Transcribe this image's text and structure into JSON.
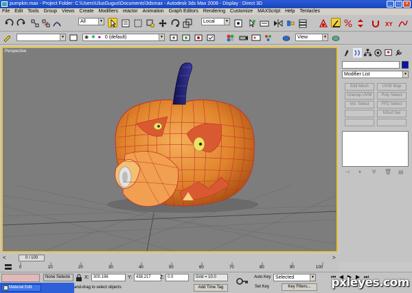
{
  "window": {
    "title": "pumpkin.max  - Project Folder: C:\\Users\\UlusGugus\\Documents\\3dsmax  - Autodesk 3ds Max 2008  - Display : Direct 3D"
  },
  "menu": [
    "File",
    "Edit",
    "Tools",
    "Group",
    "Views",
    "Create",
    "Modifiers",
    "reactor",
    "Animation",
    "Graph Editors",
    "Rendering",
    "Customize",
    "MAXScript",
    "Help",
    "Tentacles"
  ],
  "toolbar": {
    "selection_filter": "All",
    "ref_coord": "Local",
    "named_selection": "",
    "view_select": "View"
  },
  "layer_bar": {
    "layer_name": "0 (default)"
  },
  "viewport": {
    "label": "Perspective",
    "border_color": "#e8c23a",
    "bg_color": "#7d7d7d"
  },
  "command_panel": {
    "modifier_list": "Modifier List",
    "object_color": "#0a13a8",
    "buttons": [
      "Edit Mesh",
      "UVW Map",
      "Unwrap UVW",
      "Poly Select",
      "Vol. Select",
      "FFD Select",
      "",
      "NSurf Sel",
      "",
      ""
    ]
  },
  "time_slider": {
    "position": "0 / 100"
  },
  "trackbar": {
    "ticks": [
      "0",
      "10",
      "20",
      "30",
      "40",
      "50",
      "60",
      "70",
      "80",
      "90",
      "100"
    ]
  },
  "status": {
    "selection": "None Selecte",
    "x_label": "X:",
    "x_value": "300.196",
    "y_label": "Y:",
    "y_value": "438.217",
    "z_label": "Z:",
    "z_value": "0.0",
    "grid": "Grid = 10.0",
    "prompt": "Click-and-drag to select objects",
    "add_time_tag": "Add Time Tag",
    "auto_key": "Auto Key",
    "set_key": "Set Key",
    "key_mode": "Selected",
    "key_filters": "Key Filters..."
  },
  "taskbar": {
    "item": "Material Edit"
  },
  "watermark": "pxleyes.com"
}
